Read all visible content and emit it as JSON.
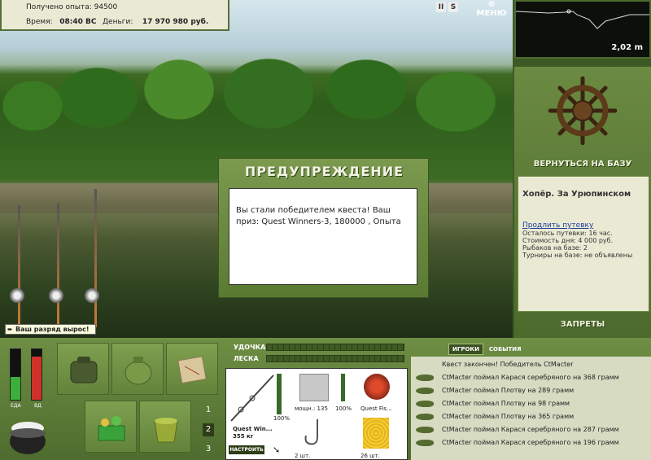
{
  "stats": {
    "exp_label": "Получено опыта:",
    "exp_value": "94500",
    "time_label": "Время:",
    "time_value": "08:40 ВС",
    "money_label": "Деньги:",
    "money_value": "17 970 980 руб."
  },
  "top": {
    "pause": "II",
    "sound": "S",
    "menu": "МЕНЮ"
  },
  "notice": "Ваш разряд вырос!",
  "dialog": {
    "title": "ПРЕДУПРЕЖДЕНИЕ",
    "message": "Вы стали победителем квеста! Ваш приз: Quest Winners-3, 180000 , Опыта"
  },
  "depth": "2,02 m",
  "right": {
    "back_base": "ВЕРНУТЬСЯ НА БАЗУ",
    "location": "Хопёр. За Урюпинском",
    "extend_link": "Продлить путевку",
    "lines": [
      "Осталось путевки: 16 час.",
      "Стоимость дня: 4 000 руб.",
      "Рыбаков на базе: 2",
      "Турниры на базе: не объявлены"
    ],
    "bans": "ЗАПРЕТЫ"
  },
  "meters": {
    "food_label": "ЕДА",
    "food_level": 0.45,
    "hp_label": "ВД",
    "hp_level": 0.85
  },
  "pages": [
    "1",
    "2",
    "3"
  ],
  "tackle": {
    "rod_label": "УДОЧКА",
    "line_label": "ЛЕСКА",
    "rod_name": "Quest Win...",
    "rod_weight": "355 кг",
    "rod_pct": "100%",
    "reel_label": "мощн.: 135",
    "reel_pct": "100%",
    "lure_name": "Quest Fis...",
    "hook_count": "2 шт.",
    "bait_count": "26 шт.",
    "tune": "НАСТРОИТЬ"
  },
  "events": {
    "tab_players": "ИГРОКИ",
    "tab_events": "СОБЫТИЯ",
    "header": "Квест закончен! Победитель CtMacter",
    "items": [
      "CtMacter поймал Карася серебряного на 368 грамм",
      "CtMacter поймал Плотву на 289 грамм",
      "CtMacter поймал Плотву на 98 грамм",
      "CtMacter поймал Плотву на 365 грамм",
      "CtMacter поймал Карася серебряного на 287 грамм",
      "CtMacter поймал Карася серебряного на 196 грамм"
    ]
  }
}
